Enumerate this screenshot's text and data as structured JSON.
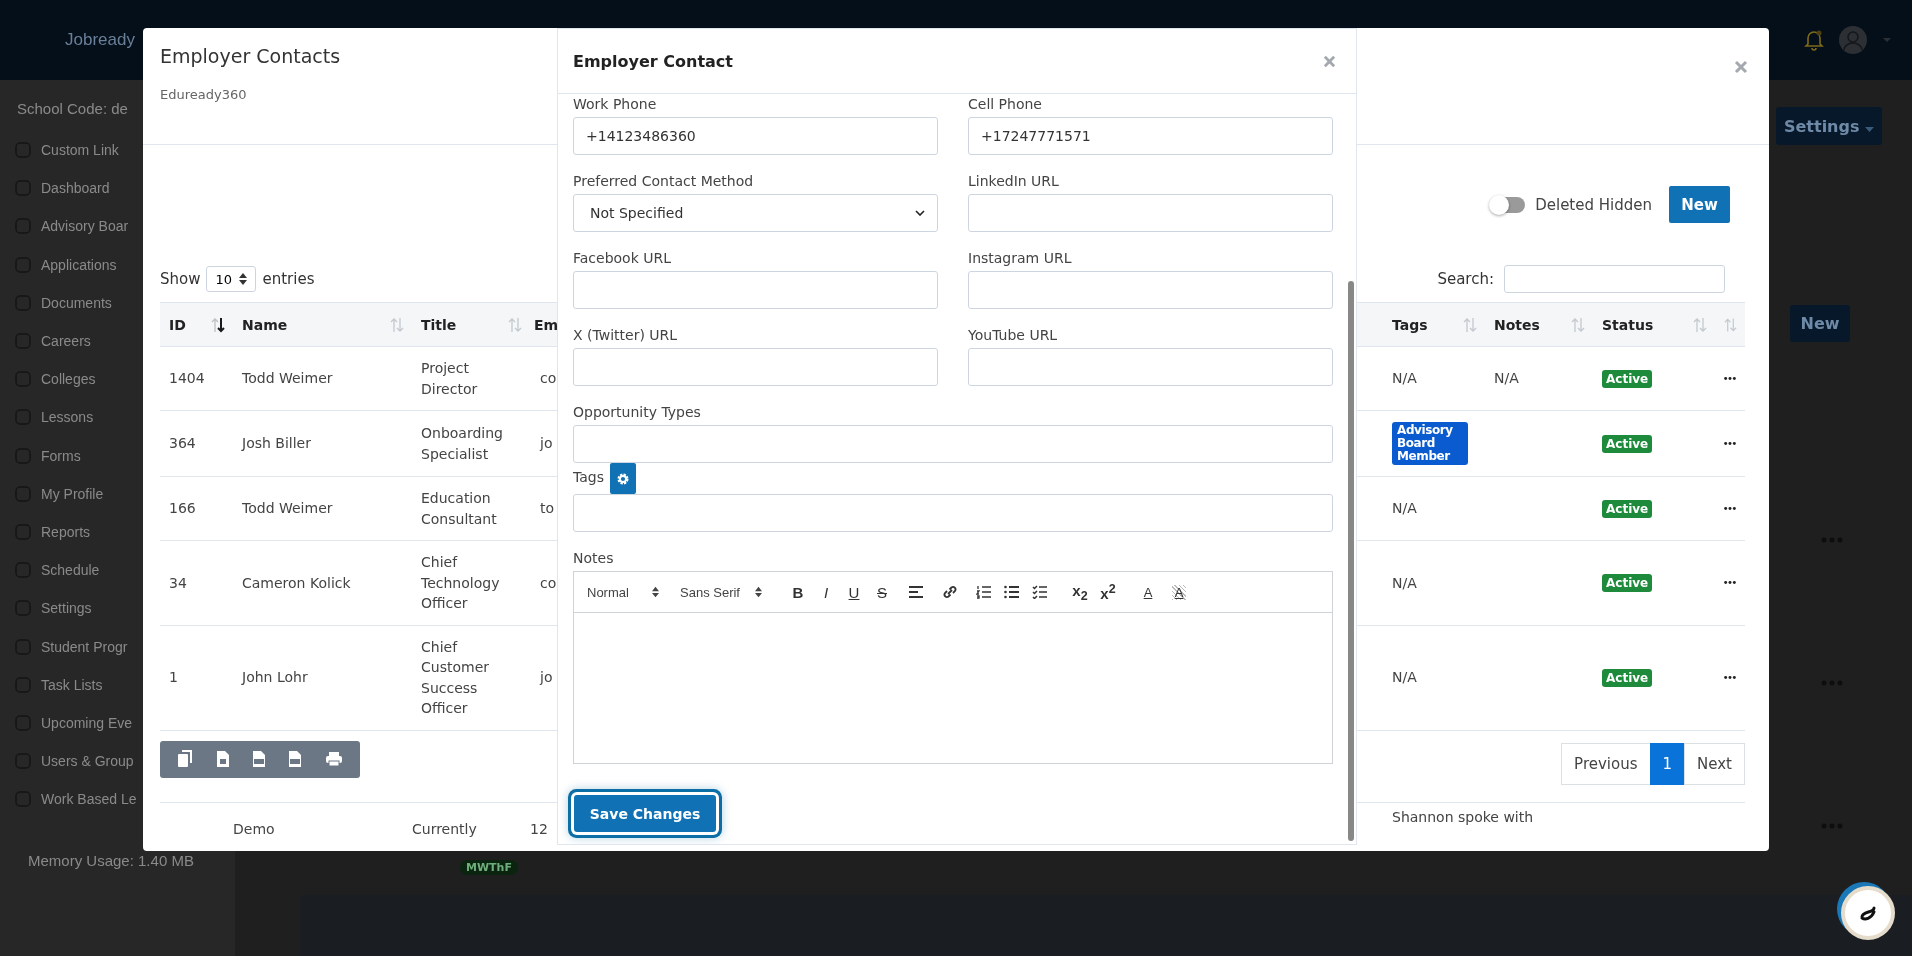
{
  "top_bar": {
    "logo": "Jobready"
  },
  "sidebar": {
    "school_code": "School Code: de",
    "items": [
      "Custom Link",
      "Dashboard",
      "Advisory Boar",
      "Applications",
      "Documents",
      "Careers",
      "Colleges",
      "Lessons",
      "Forms",
      "My Profile",
      "Reports",
      "Schedule",
      "Settings",
      "Student Progr",
      "Task Lists",
      "Upcoming Eve",
      "Users & Group",
      "Work Based Le"
    ],
    "memory_usage": "Memory Usage: 1.40 MB"
  },
  "page": {
    "settings_button": "Settings",
    "new_button": "New",
    "schedule_badge": "MWThF"
  },
  "contacts_modal": {
    "title": "Employer Contacts",
    "subtitle": "Eduready360",
    "deleted_toggle": {
      "label": "Deleted Hidden",
      "on": false
    },
    "new_button": "New",
    "show_label": "Show",
    "page_size": "10",
    "entries_label": "entries",
    "search_label": "Search:",
    "columns": [
      {
        "label": "ID",
        "sortable": true,
        "sorted_descending": true
      },
      {
        "label": "Name",
        "sortable": true,
        "sorted_descending": false
      },
      {
        "label": "Title",
        "sortable": true,
        "sorted_descending": false
      },
      {
        "label": "Em"
      },
      {
        "label": "Tags",
        "sortable": true,
        "sorted_descending": false
      },
      {
        "label": "Notes",
        "sortable": true,
        "sorted_descending": false
      },
      {
        "label": "Status",
        "sortable": true,
        "sorted_descending": false
      },
      {
        "sortable": true,
        "sorted_descending": false
      }
    ],
    "rows": [
      {
        "id": "1404",
        "name": "Todd Weimer",
        "title": "Project Director",
        "email": "co",
        "tags": {
          "kind": "text",
          "label": "N/A"
        },
        "notes": "N/A",
        "status": "Active"
      },
      {
        "id": "364",
        "name": "Josh Biller",
        "title": "Onboarding Specialist",
        "email": "jo",
        "tags": {
          "kind": "tag",
          "label": "Advisory Board Member"
        },
        "status": "Active"
      },
      {
        "id": "166",
        "name": "Todd Weimer",
        "title": "Education Consultant",
        "email": "to",
        "tags": {
          "kind": "text",
          "label": "N/A"
        },
        "status": "Active"
      },
      {
        "id": "34",
        "name": "Cameron Kolick",
        "title": "Chief Technology Officer",
        "email": "co",
        "tags": {
          "kind": "text",
          "label": "N/A"
        },
        "status": "Active"
      },
      {
        "id": "1",
        "name": "John Lohr",
        "title": "Chief Customer Success Officer",
        "email": "jo",
        "tags": {
          "kind": "text",
          "label": "N/A"
        },
        "status": "Active"
      }
    ],
    "export_buttons": [
      {
        "kind": "copy"
      },
      {
        "kind": "excel"
      },
      {
        "kind": "csv"
      },
      {
        "kind": "pdf"
      },
      {
        "kind": "print"
      }
    ],
    "pagination": [
      {
        "label": "Previous",
        "selected": false
      },
      {
        "label": "1",
        "selected": true
      },
      {
        "label": "Next",
        "selected": false
      }
    ],
    "partial_row": {
      "name": "Demo",
      "title": "Currently",
      "email": "12",
      "tags": "Shannon spoke with"
    }
  },
  "contact_modal": {
    "title": "Employer Contact",
    "fields": [
      {
        "label": "Work Phone",
        "kind": "text",
        "value": "+14123486360"
      },
      {
        "label": "Cell Phone",
        "kind": "text",
        "value": "+17247771571"
      },
      {
        "label": "Preferred Contact Method",
        "kind": "select",
        "value": "Not Specified"
      },
      {
        "label": "LinkedIn URL",
        "kind": "text"
      },
      {
        "label": "Facebook URL",
        "kind": "text"
      },
      {
        "label": "Instagram URL",
        "kind": "text"
      },
      {
        "label": "X (Twitter) URL",
        "kind": "text"
      },
      {
        "label": "YouTube URL",
        "kind": "text"
      }
    ],
    "opportunity_types": {
      "label": "Opportunity Types"
    },
    "tags": {
      "label": "Tags"
    },
    "notes": {
      "label": "Notes",
      "toolbar": [
        {
          "kind": "header_select",
          "label": "Normal"
        },
        {
          "kind": "font_select",
          "label": "Sans Serif"
        },
        {
          "kind": "bold",
          "label": "B"
        },
        {
          "kind": "italic",
          "label": "I"
        },
        {
          "kind": "underline",
          "label": "U"
        },
        {
          "kind": "strike",
          "label": "S"
        },
        {
          "kind": "align"
        },
        {
          "kind": "link"
        },
        {
          "kind": "ordered_list"
        },
        {
          "kind": "bullet_list"
        },
        {
          "kind": "check_list"
        },
        {
          "kind": "subscript",
          "label": "x$_{2}$"
        },
        {
          "kind": "superscript",
          "label": "x$^{2}$"
        },
        {
          "kind": "color",
          "label": "A"
        },
        {
          "kind": "background",
          "label": "A"
        }
      ]
    },
    "save_button": "Save Changes"
  }
}
